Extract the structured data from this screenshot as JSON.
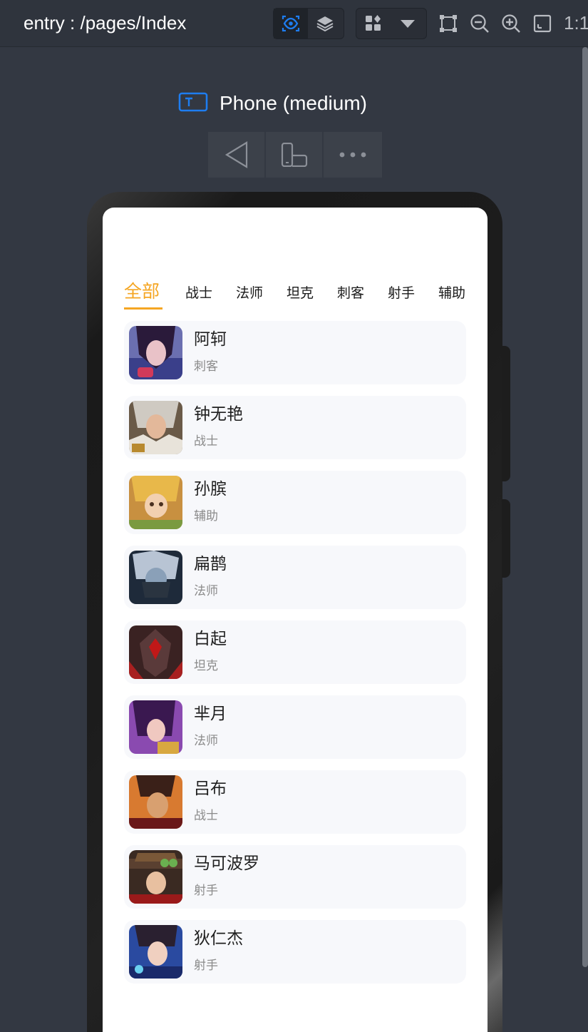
{
  "toolbar": {
    "entry_title": "entry : /pages/Index",
    "ratio_label": "1:1",
    "icons": [
      "inspect-eye-icon",
      "layers-icon",
      "components-icon",
      "dropdown-icon",
      "fit-frame-icon",
      "zoom-out-icon",
      "zoom-in-icon",
      "fullscreen-icon"
    ]
  },
  "device": {
    "label": "Phone (medium)",
    "controls": [
      "back-icon",
      "rotate-device-icon",
      "more-icon"
    ]
  },
  "app": {
    "tabs": [
      {
        "label": "全部",
        "active": true
      },
      {
        "label": "战士",
        "active": false
      },
      {
        "label": "法师",
        "active": false
      },
      {
        "label": "坦克",
        "active": false
      },
      {
        "label": "刺客",
        "active": false
      },
      {
        "label": "射手",
        "active": false
      },
      {
        "label": "辅助",
        "active": false
      }
    ],
    "accent_color": "#f5a623",
    "heroes": [
      {
        "name": "阿轲",
        "role": "刺客"
      },
      {
        "name": "钟无艳",
        "role": "战士"
      },
      {
        "name": "孙膑",
        "role": "辅助"
      },
      {
        "name": "扁鹊",
        "role": "法师"
      },
      {
        "name": "白起",
        "role": "坦克"
      },
      {
        "name": "芈月",
        "role": "法师"
      },
      {
        "name": "吕布",
        "role": "战士"
      },
      {
        "name": "马可波罗",
        "role": "射手"
      },
      {
        "name": "狄仁杰",
        "role": "射手"
      }
    ]
  }
}
